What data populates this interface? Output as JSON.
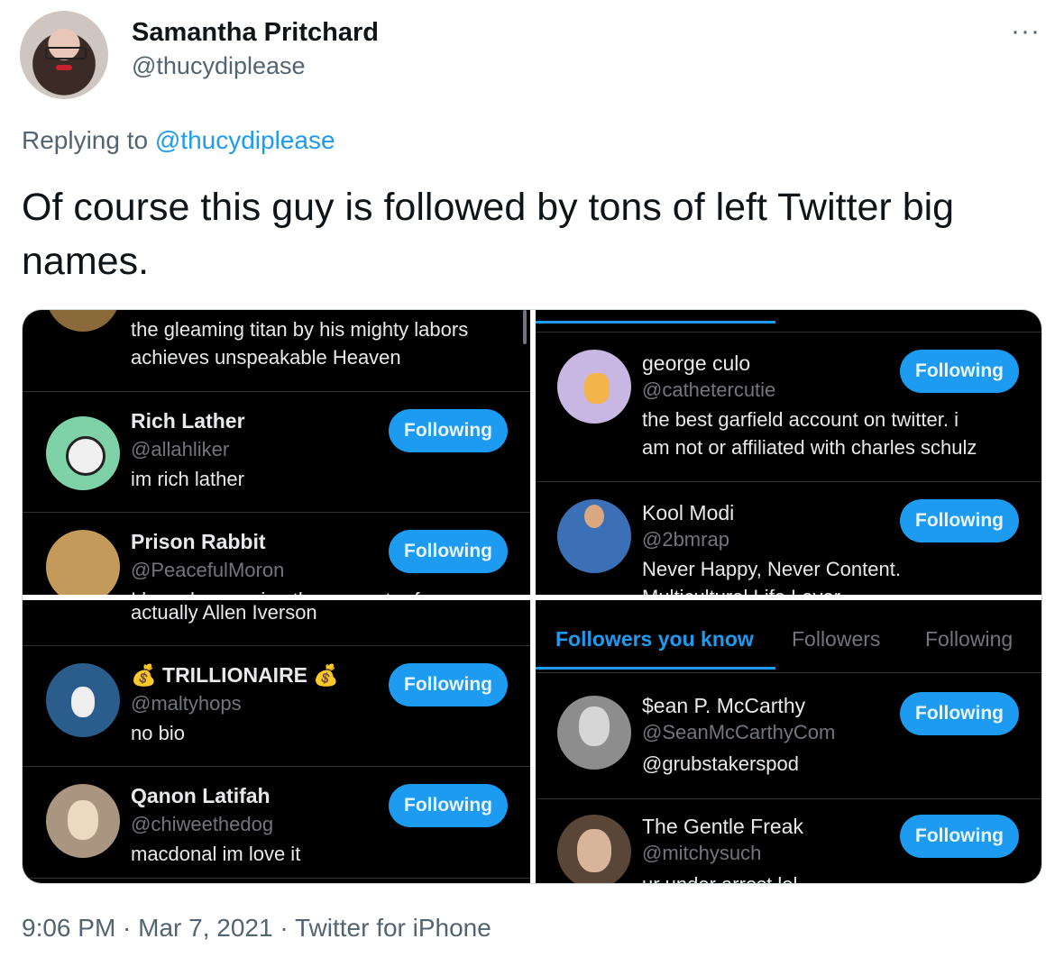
{
  "tweet": {
    "author": {
      "name": "Samantha Pritchard",
      "handle": "@thucydiplease"
    },
    "more_label": "···",
    "replying_prefix": "Replying to",
    "replying_to": "@thucydiplease",
    "text": "Of course this guy is followed by tons of left Twitter big names.",
    "meta": "9:06 PM · Mar 7, 2021 · Twitter for iPhone"
  },
  "media": {
    "q1": {
      "top_bio": [
        "the gleaming titan by his mighty labors",
        "achieves unspeakable Heaven"
      ],
      "users": [
        {
          "name": "Rich Lather",
          "handle": "@allahliker",
          "bio": "im rich lather",
          "button": "Following"
        },
        {
          "name": "Prison Rabbit",
          "handle": "@PeacefulMoron",
          "bio": "I have been using the computer for",
          "button": "Following"
        }
      ]
    },
    "q2": {
      "users": [
        {
          "name": "george culo",
          "handle": "@cathetercutie",
          "bio": [
            "the best garfield account on twitter. i",
            "am not or affiliated with charles schulz"
          ],
          "button": "Following"
        },
        {
          "name": "Kool Modi",
          "handle": "@2bmrap",
          "bio": [
            "Never Happy, Never Content.",
            "Multicultural Life Lover"
          ],
          "button": "Following"
        }
      ]
    },
    "q3": {
      "top_bio": "actually Allen Iverson",
      "users": [
        {
          "name": "💰 TRILLIONAIRE 💰",
          "handle": "@maltyhops",
          "bio": "no bio",
          "button": "Following"
        },
        {
          "name": "Qanon Latifah",
          "handle": "@chiweethedog",
          "bio": "macdonal im love it",
          "button": "Following"
        }
      ]
    },
    "q4": {
      "tabs": [
        "Followers you know",
        "Followers",
        "Following"
      ],
      "active_tab": 0,
      "users": [
        {
          "name": "$ean P. McCarthy",
          "handle": "@SeanMcCarthyCom",
          "bio": "@grubstakerspod",
          "button": "Following"
        },
        {
          "name": "The Gentle Freak",
          "handle": "@mitchysuch",
          "bio": "ur under arrest lol",
          "button": "Following"
        }
      ]
    }
  }
}
